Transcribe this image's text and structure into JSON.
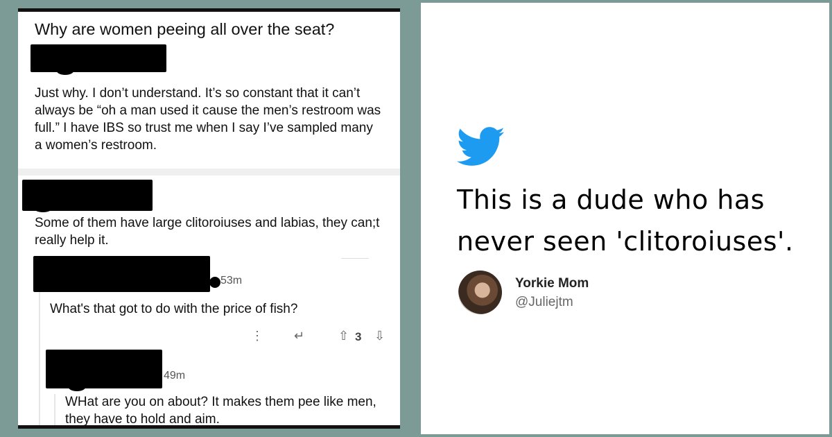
{
  "reddit_thread": {
    "post": {
      "title": "Why are women peeing all over the seat?",
      "body": "Just why. I don’t understand.  It’s so constant that it can’t always be “oh a man used it cause the men’s restroom was full.” I have IBS so trust me when I say I’ve sampled many a women’s restroom."
    },
    "comments": [
      {
        "body": "Some of them have large clitoroiuses and labias, they can;t really help it."
      },
      {
        "timestamp": "53m",
        "body": "What's that got to do with the price of fish?",
        "upvotes": "3"
      },
      {
        "timestamp": "49m",
        "body": "WHat are you on about? It makes them pee like men, they have to hold and aim."
      }
    ]
  },
  "tweet": {
    "icon": "twitter-bird-icon",
    "text": "This is a dude who has never seen 'clitoroiuses'.",
    "author_name": "Yorkie Mom",
    "author_handle": "@Juliejtm"
  },
  "colors": {
    "frame": "#7d9b96",
    "twitter_blue": "#1d9bf0"
  }
}
